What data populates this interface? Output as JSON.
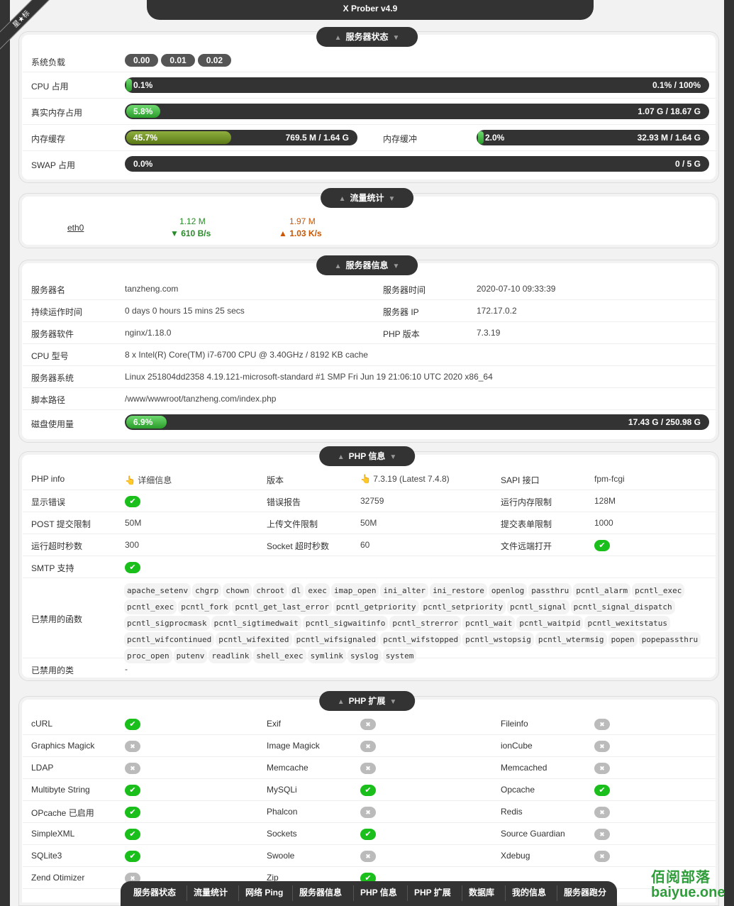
{
  "app": {
    "title": "X Prober v4.9",
    "ribbon_text": "星★标"
  },
  "server_status": {
    "title": "服务器状态",
    "load_label": "系统负载",
    "load_values": [
      "0.00",
      "0.01",
      "0.02"
    ],
    "cpu": {
      "label": "CPU 占用",
      "pct": "0.1%",
      "amount": "0.1% / 100%",
      "fill": 0.001
    },
    "real_mem": {
      "label": "真实内存占用",
      "pct": "5.8%",
      "amount": "1.07 G / 18.67 G",
      "fill": 0.058
    },
    "mem_cache": {
      "label": "内存缓存",
      "pct": "45.7%",
      "amount": "769.5 M / 1.64 G",
      "fill": 0.457
    },
    "mem_buffer": {
      "label": "内存缓冲",
      "pct": "2.0%",
      "amount": "32.93 M / 1.64 G",
      "fill": 0.02
    },
    "swap": {
      "label": "SWAP 占用",
      "pct": "0.0%",
      "amount": "0 / 5 G",
      "fill": 0
    }
  },
  "network": {
    "title": "流量统计",
    "iface": "eth0",
    "rx_total": "1.12 M",
    "rx_rate": "▼ 610 B/s",
    "tx_total": "1.97 M",
    "tx_rate": "▲ 1.03 K/s"
  },
  "server_info": {
    "title": "服务器信息",
    "rows": [
      {
        "label": "服务器名",
        "value": "tanzheng.com",
        "label2": "服务器时间",
        "value2": "2020-07-10 09:33:39"
      },
      {
        "label": "持续运作时间",
        "value": "0 days 0 hours 15 mins 25 secs",
        "label2": "服务器 IP",
        "value2": "172.17.0.2"
      },
      {
        "label": "服务器软件",
        "value": "nginx/1.18.0",
        "label2": "PHP 版本",
        "value2": "7.3.19"
      },
      {
        "label": "CPU 型号",
        "value": "8 x Intel(R) Core(TM) i7-6700 CPU @ 3.40GHz / 8192 KB cache"
      },
      {
        "label": "服务器系统",
        "value": "Linux 251804dd2358 4.19.121-microsoft-standard #1 SMP Fri Jun 19 21:06:10 UTC 2020 x86_64"
      },
      {
        "label": "脚本路径",
        "value": "/www/wwwroot/tanzheng.com/index.php"
      }
    ],
    "disk": {
      "label": "磁盘使用量",
      "pct": "6.9%",
      "amount": "17.43 G / 250.98 G",
      "fill": 0.069
    }
  },
  "php_info": {
    "title": "PHP 信息",
    "rows": [
      [
        "PHP info",
        "👆 详细信息",
        "版本",
        "👆 7.3.19 (Latest 7.4.8)",
        "SAPI 接口",
        "fpm-fcgi"
      ],
      [
        "显示错误",
        "✔",
        "错误报告",
        "32759",
        "运行内存限制",
        "128M"
      ],
      [
        "POST 提交限制",
        "50M",
        "上传文件限制",
        "50M",
        "提交表单限制",
        "1000"
      ],
      [
        "运行超时秒数",
        "300",
        "Socket 超时秒数",
        "60",
        "文件远端打开",
        "✔"
      ]
    ],
    "smtp_label": "SMTP 支持",
    "smtp_check": "✔",
    "disabled_functions_label": "已禁用的函数",
    "disabled_functions": [
      "apache_setenv",
      "chgrp",
      "chown",
      "chroot",
      "dl",
      "exec",
      "imap_open",
      "ini_alter",
      "ini_restore",
      "openlog",
      "passthru",
      "pcntl_alarm",
      "pcntl_exec",
      "pcntl_exec",
      "pcntl_fork",
      "pcntl_get_last_error",
      "pcntl_getpriority",
      "pcntl_setpriority",
      "pcntl_signal",
      "pcntl_signal_dispatch",
      "pcntl_sigprocmask",
      "pcntl_sigtimedwait",
      "pcntl_sigwaitinfo",
      "pcntl_strerror",
      "pcntl_wait",
      "pcntl_waitpid",
      "pcntl_wexitstatus",
      "pcntl_wifcontinued",
      "pcntl_wifexited",
      "pcntl_wifsignaled",
      "pcntl_wifstopped",
      "pcntl_wstopsig",
      "pcntl_wtermsig",
      "popen",
      "popepassthru",
      "proc_open",
      "putenv",
      "readlink",
      "shell_exec",
      "symlink",
      "syslog",
      "system"
    ],
    "disabled_classes_label": "已禁用的类",
    "disabled_classes": "-"
  },
  "php_ext": {
    "title": "PHP 扩展",
    "ok_glyph": "✔",
    "no_glyph": "✖",
    "items": [
      {
        "name": "cURL",
        "ok": true
      },
      {
        "name": "Exif",
        "ok": false
      },
      {
        "name": "Fileinfo",
        "ok": false
      },
      {
        "name": "Graphics Magick",
        "ok": false
      },
      {
        "name": "Image Magick",
        "ok": false
      },
      {
        "name": "ionCube",
        "ok": false
      },
      {
        "name": "LDAP",
        "ok": false
      },
      {
        "name": "Memcache",
        "ok": false
      },
      {
        "name": "Memcached",
        "ok": false
      },
      {
        "name": "Multibyte String",
        "ok": true
      },
      {
        "name": "MySQLi",
        "ok": true
      },
      {
        "name": "Opcache",
        "ok": true
      },
      {
        "name": "OPcache 已启用",
        "ok": true
      },
      {
        "name": "Phalcon",
        "ok": false
      },
      {
        "name": "Redis",
        "ok": false
      },
      {
        "name": "SimpleXML",
        "ok": true
      },
      {
        "name": "Sockets",
        "ok": true
      },
      {
        "name": "Source Guardian",
        "ok": false
      },
      {
        "name": "SQLite3",
        "ok": true
      },
      {
        "name": "Swoole",
        "ok": false
      },
      {
        "name": "Xdebug",
        "ok": false
      },
      {
        "name": "Zend Otimizer",
        "ok": false
      },
      {
        "name": "Zip",
        "ok": true
      }
    ]
  },
  "bottom_nav": [
    "服务器状态",
    "流量统计",
    "网络 Ping",
    "服务器信息",
    "PHP 信息",
    "PHP 扩展",
    "数据库",
    "我的信息",
    "服务器跑分"
  ],
  "watermark": {
    "top": "佰阅部落",
    "bottom": "baiyue.one"
  },
  "colors": {
    "ok": "#1bbf1b",
    "rx": "#2a8a2a",
    "tx": "#cc5500",
    "bar_bg": "#333333"
  }
}
